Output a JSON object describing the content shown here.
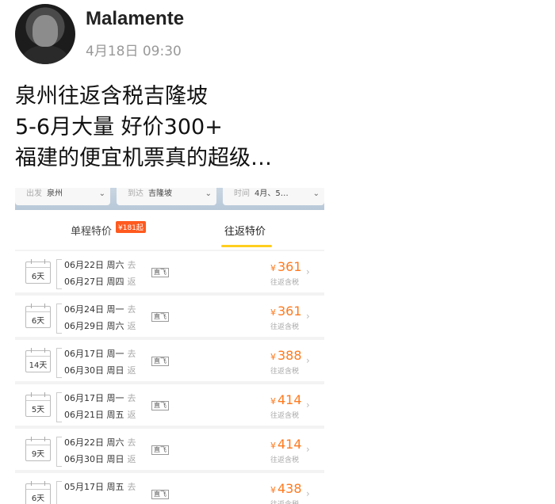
{
  "post": {
    "username": "Malamente",
    "time": "4月18日 09:30",
    "lines": [
      "泉州往返含税吉隆坡",
      "5-6月大量 好价300+",
      "福建的便宜机票真的超级…"
    ]
  },
  "screenshot": {
    "filters": [
      {
        "label": "出发",
        "value": "泉州"
      },
      {
        "label": "到达",
        "value": "吉隆坡"
      },
      {
        "label": "时间",
        "value": "4月、5…"
      }
    ],
    "tabs": {
      "oneway": "单程特价",
      "oneway_badge": "¥181起",
      "round": "往返特价"
    },
    "rows": [
      {
        "days": "6天",
        "d1": "06月22日 周六",
        "d2": "06月27日 周四",
        "price": "361"
      },
      {
        "days": "6天",
        "d1": "06月24日 周一",
        "d2": "06月29日 周六",
        "price": "361"
      },
      {
        "days": "14天",
        "d1": "06月17日 周一",
        "d2": "06月30日 周日",
        "price": "388"
      },
      {
        "days": "5天",
        "d1": "06月17日 周一",
        "d2": "06月21日 周五",
        "price": "414"
      },
      {
        "days": "9天",
        "d1": "06月22日 周六",
        "d2": "06月30日 周日",
        "price": "414"
      },
      {
        "days": "6天",
        "d1": "05月17日 周五",
        "d2": "",
        "price": "438"
      }
    ],
    "go_tag": "去",
    "return_tag": "返",
    "direct": "直飞",
    "currency": "¥",
    "price_note": "往返含税"
  }
}
